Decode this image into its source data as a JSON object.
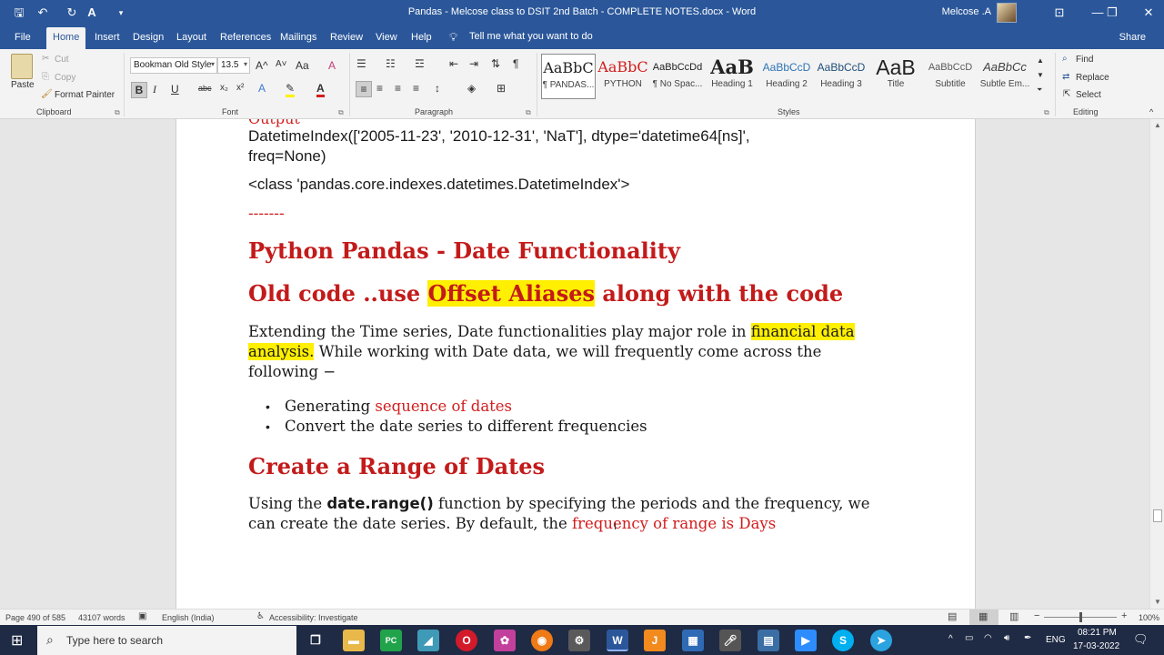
{
  "titlebar": {
    "title": "Pandas  - Melcose class to DSIT 2nd Batch - COMPLETE NOTES.docx  -  Word",
    "user": "Melcose .A",
    "quick_access": {
      "save": "🖫",
      "undo": "↶",
      "redo": "↻",
      "spelling": "A",
      "customize": "▾"
    },
    "window_controls": {
      "ribbon_options": "⊡",
      "minimize": "—",
      "restore": "❐",
      "close": "✕"
    }
  },
  "tabs": {
    "items": [
      "File",
      "Home",
      "Insert",
      "Design",
      "Layout",
      "References",
      "Mailings",
      "Review",
      "View",
      "Help"
    ],
    "tell_me": "Tell me what you want to do",
    "share": "Share"
  },
  "ribbon": {
    "clipboard": {
      "paste": "Paste",
      "cut": "Cut",
      "copy": "Copy",
      "format_painter": "Format Painter",
      "label": "Clipboard"
    },
    "font": {
      "name": "Bookman Old Style",
      "size": "13.5",
      "label": "Font",
      "bold": "B",
      "italic": "I",
      "underline": "U",
      "strike": "abc",
      "subscript": "x₂",
      "superscript": "x²",
      "grow": "A^",
      "shrink": "A˅",
      "case": "Aa",
      "clear": "A"
    },
    "paragraph": {
      "label": "Paragraph"
    },
    "styles": {
      "label": "Styles",
      "items": [
        {
          "preview": "AaBbC",
          "name": "¶ PANDAS..."
        },
        {
          "preview": "AaBbC",
          "name": "PYTHON"
        },
        {
          "preview": "AaBbCcDd",
          "name": "¶ No Spac..."
        },
        {
          "preview": "AaB",
          "name": "Heading 1"
        },
        {
          "preview": "AaBbCcD",
          "name": "Heading 2"
        },
        {
          "preview": "AaBbCcD",
          "name": "Heading 3"
        },
        {
          "preview": "AaB",
          "name": "Title"
        },
        {
          "preview": "AaBbCcD",
          "name": "Subtitle"
        },
        {
          "preview": "AaBbCc",
          "name": "Subtle Em..."
        }
      ]
    },
    "editing": {
      "label": "Editing",
      "find": "Find",
      "replace": "Replace",
      "select": "Select"
    }
  },
  "document": {
    "output_label": "Output",
    "code_line1": "DatetimeIndex(['2005-11-23', '2010-12-31', 'NaT'], dtype='datetime64[ns]',",
    "code_line2": "freq=None)",
    "class_line": "<class 'pandas.core.indexes.datetimes.DatetimeIndex'>",
    "separator": "-------",
    "heading1": "Python Pandas - Date Functionality",
    "heading2_before": "Old code ..use ",
    "heading2_highlight": "Offset Aliases",
    "heading2_after": " along with the code",
    "para1_a": "Extending the Time series, Date functionalities play major role in ",
    "para1_hl1": "financial data",
    "para1_hl2": "analysis.",
    "para1_b": " While working with Date data, we will frequently come across the",
    "para1_c": "following −",
    "bullet1_a": "Generating ",
    "bullet1_b": "sequence of dates",
    "bullet2": "Convert the date series to different frequencies",
    "heading3": "Create a Range of Dates",
    "para2_a": "Using the ",
    "para2_bold": "date.range()",
    "para2_b": " function by specifying the periods and the frequency, we",
    "para2_c": "can create the date series. By default, the ",
    "para2_red": "frequency of range is Days"
  },
  "status": {
    "page": "Page 490 of 585",
    "words": "43107 words",
    "language": "English (India)",
    "accessibility": "Accessibility: Investigate",
    "zoom": "100%"
  },
  "taskbar": {
    "search_placeholder": "Type here to search",
    "language": "ENG",
    "time": "08:21 PM",
    "date": "17-03-2022"
  },
  "colors": {
    "word_blue": "#2b579a",
    "heading_red": "#c31a1a",
    "highlight": "#ffef00",
    "taskbar": "#1f2a44"
  }
}
